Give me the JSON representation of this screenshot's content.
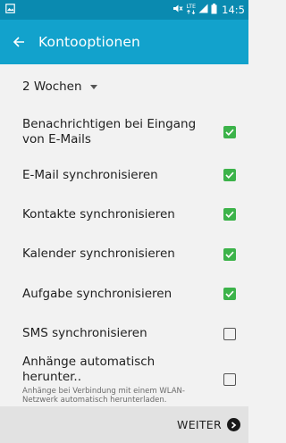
{
  "status_bar": {
    "time": "14:5",
    "network_label": "LTE",
    "icons": [
      "gallery-icon",
      "mute-icon",
      "lte-icon",
      "signal-icon",
      "battery-icon"
    ]
  },
  "app_bar": {
    "title": "Kontooptionen",
    "back_icon": "arrow-back-icon"
  },
  "sync_period": {
    "selected": "2 Wochen"
  },
  "settings": [
    {
      "label": "Benachrichtigen bei Eingang von E-Mails",
      "checked": true
    },
    {
      "label": "E-Mail synchronisieren",
      "checked": true
    },
    {
      "label": "Kontakte synchronisieren",
      "checked": true
    },
    {
      "label": "Kalender synchronisieren",
      "checked": true
    },
    {
      "label": "Aufgabe synchronisieren",
      "checked": true
    },
    {
      "label": "SMS synchronisieren",
      "checked": false
    },
    {
      "label": "Anhänge automatisch herunter..",
      "sublabel": "Anhänge bei Verbindung mit einem WLAN-Netzwerk automatisch herunterladen.",
      "checked": false
    }
  ],
  "footer": {
    "next_label": "WEITER"
  },
  "colors": {
    "status_bar": "#0a8ab0",
    "app_bar": "#12a2cc",
    "checkbox_on": "#3cb34a",
    "background": "#f2f2f2",
    "footer": "#e2e2e2"
  }
}
